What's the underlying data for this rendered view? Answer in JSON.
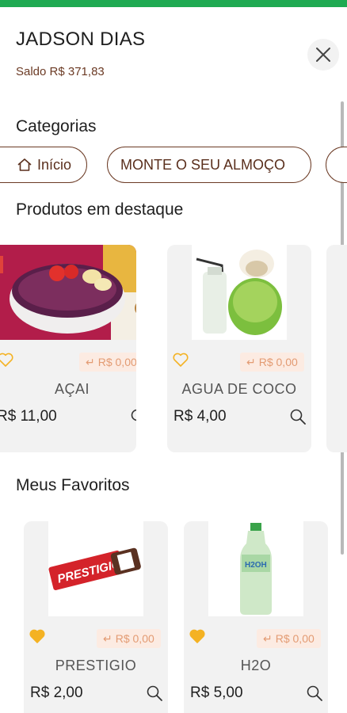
{
  "colors": {
    "top_bar": "#1faa52",
    "brown": "#6b3a24",
    "fav_active": "#f4b223",
    "fav_inactive": "#f4b223",
    "cashback_text": "#e39b73"
  },
  "user": {
    "name": "JADSON DIAS",
    "balance": "Saldo R$ 371,83"
  },
  "close_icon": "close-icon",
  "categories": {
    "title": "Categorias",
    "chips": [
      {
        "label": "Início",
        "icon": "home-icon"
      },
      {
        "label": "MONTE O SEU ALMOÇO"
      }
    ]
  },
  "featured": {
    "title": "Produtos em destaque",
    "products": [
      {
        "name": "AÇAI",
        "price": "R$ 11,00",
        "cashback": "R$ 0,00",
        "favorite": false,
        "image": "acai-bowl-image"
      },
      {
        "name": "AGUA DE COCO",
        "price": "R$ 4,00",
        "cashback": "R$ 0,00",
        "favorite": false,
        "image": "coconut-water-image"
      }
    ]
  },
  "favorites": {
    "title": "Meus Favoritos",
    "products": [
      {
        "name": "PRESTIGIO",
        "price": "R$ 2,00",
        "cashback": "R$ 0,00",
        "favorite": true,
        "image": "prestigio-bar-image"
      },
      {
        "name": "H2O",
        "price": "R$ 5,00",
        "cashback": "R$ 0,00",
        "favorite": true,
        "image": "h2o-bottle-image"
      }
    ]
  }
}
